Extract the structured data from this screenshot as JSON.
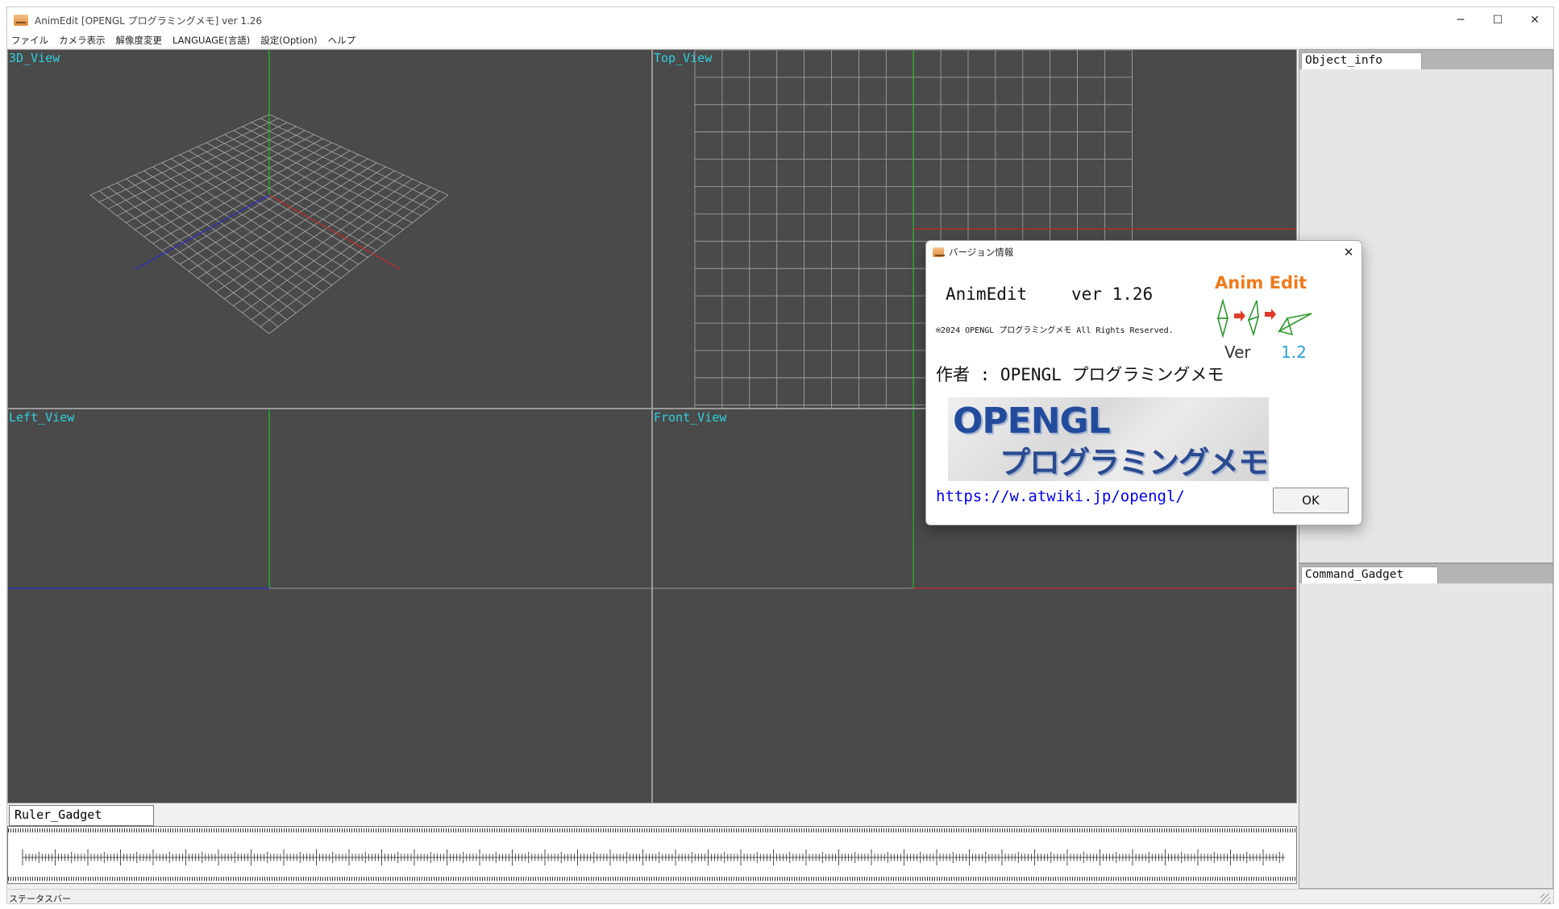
{
  "window": {
    "title": "AnimEdit [OPENGL プログラミングメモ] ver 1.26",
    "controls": {
      "minimize": "─",
      "maximize": "☐",
      "close": "✕"
    }
  },
  "menu": [
    "ファイル",
    "カメラ表示",
    "解像度変更",
    "LANGUAGE(言語)",
    "設定(Option)",
    "ヘルプ"
  ],
  "views": {
    "view3d": "3D_View",
    "top": "Top_View",
    "left": "Left_View",
    "front": "Front_View"
  },
  "panels": {
    "object_info": "Object_info",
    "command_gadget": "Command_Gadget",
    "ruler_gadget": "Ruler_Gadget"
  },
  "status": "ステータスバー",
  "dialog": {
    "title": "バージョン情報",
    "close": "✕",
    "app_name": "AnimEdit",
    "version": "ver 1.26",
    "copyright": "®2024 OPENGL プログラミングメモ All Rights Reserved.",
    "author": "作者 : OPENGL プログラミングメモ",
    "banner_line1": "OPENGL",
    "banner_line2": "プログラミングメモ",
    "link": "https://w.atwiki.jp/opengl/",
    "ok": "OK",
    "logo_title": "Anim Edit",
    "logo_ver": "Ver",
    "logo_num": "1.2"
  },
  "colors": {
    "viewport_bg": "#4a4a4a",
    "view_label": "#2fd0dd",
    "axis_x": "#c82828",
    "axis_y": "#22b822",
    "axis_z": "#2a2ad0",
    "grid": "#a8a8a8",
    "logo_orange": "#f07a1c",
    "logo_blue": "#2aa3d8",
    "link": "#0000ee"
  }
}
